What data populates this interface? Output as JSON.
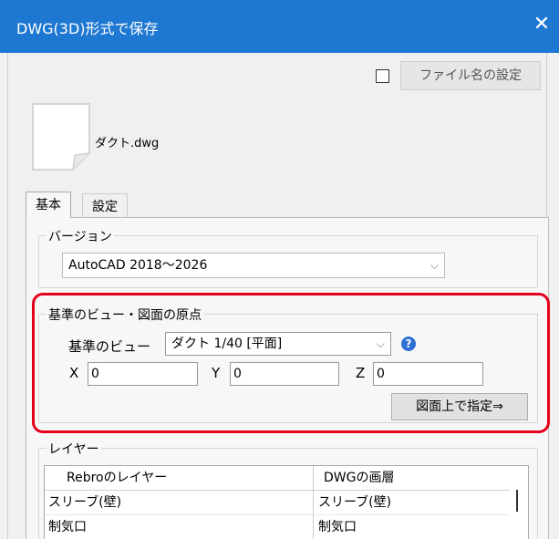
{
  "window": {
    "title": "DWG(3D)形式で保存",
    "close_label": "✕"
  },
  "filename_setting": {
    "label": "ファイル名の設定",
    "checked": false
  },
  "file": {
    "name": "ダクト.dwg"
  },
  "tabs": [
    {
      "label": "基本",
      "active": true
    },
    {
      "label": "設定",
      "active": false
    }
  ],
  "version": {
    "group_label": "バージョン",
    "value": "AutoCAD 2018～2026"
  },
  "reference": {
    "group_label": "基準のビュー・図面の原点",
    "view_label": "基準のビュー",
    "view_value": "ダクト 1/40 [平面]",
    "x_label": "X",
    "x_value": "0",
    "y_label": "Y",
    "y_value": "0",
    "z_label": "Z",
    "z_value": "0",
    "pick_button": "図面上で指定⇒"
  },
  "layers": {
    "group_label": "レイヤー",
    "headers": [
      "Rebroのレイヤー",
      "DWGの画層"
    ],
    "rows": [
      [
        "スリーブ(壁)",
        "スリーブ(壁)"
      ],
      [
        "制気口",
        "制気口"
      ]
    ]
  },
  "colors": {
    "titlebar": "#1e78d2",
    "highlight": "#e5001b",
    "help_icon": "#2d6fd4"
  }
}
